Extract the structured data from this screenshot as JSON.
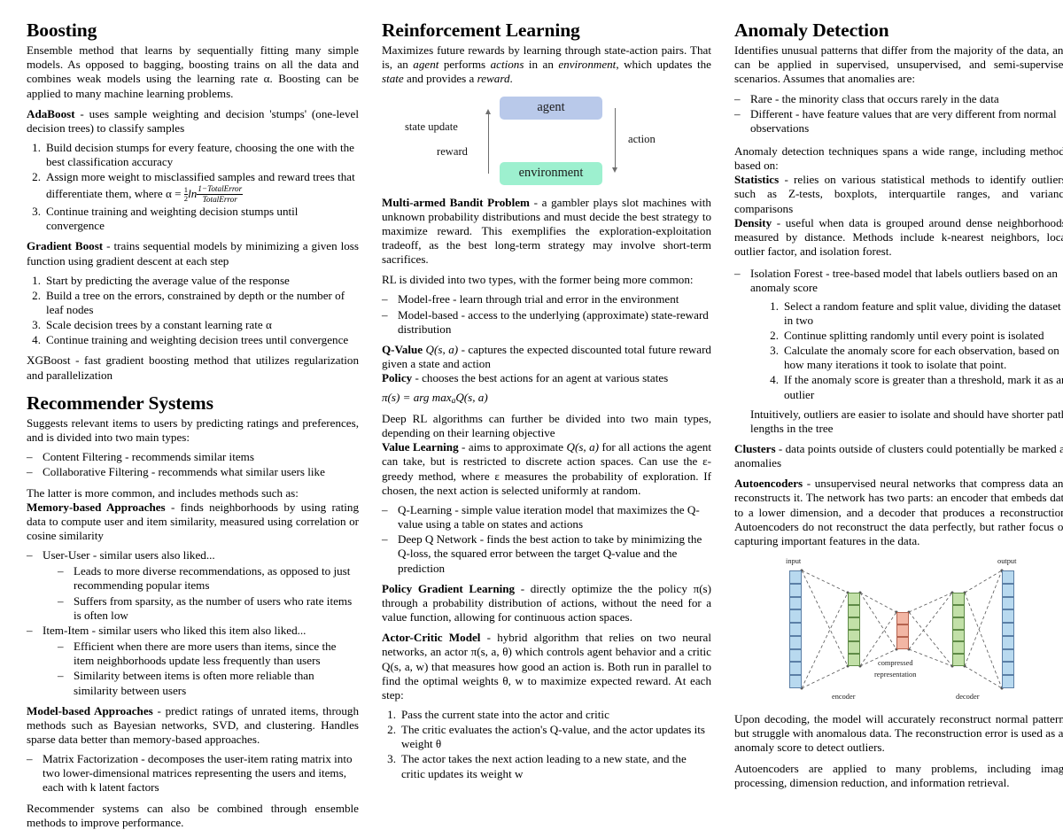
{
  "colors": {
    "agent_box": "#b9c9ea",
    "environment_box": "#9df0cf",
    "ae_input": "#b8d9ef",
    "ae_hidden": "#c2e0a8",
    "ae_compressed": "#f2b6a4",
    "ae_line": "#555555",
    "page_bg": "#ffffff",
    "text": "#000000"
  },
  "left_column": {
    "boosting": {
      "heading": "Boosting",
      "intro": "Ensemble method that learns by sequentially fitting many simple models. As opposed to bagging, boosting trains on all the data and combines weak models using the learning rate α. Boosting can be applied to many machine learning problems.",
      "adaboost_term": "AdaBoost",
      "adaboost_desc": " - uses sample weighting and decision 'stumps' (one-level decision trees) to classify samples",
      "adaboost_steps": [
        {
          "n": "1.",
          "text": "Build decision stumps for every feature, choosing the one with the best classification accuracy"
        },
        {
          "n": "2.",
          "text_before": "Assign more weight to misclassified samples and reward trees that differentiate them, where α = ",
          "formula_numerator": "1−TotalError",
          "formula_denominator": "TotalError",
          "formula_coefficient": "ln"
        },
        {
          "n": "3.",
          "text": "Continue training and weighting decision stumps until convergence"
        }
      ],
      "gradient_term": "Gradient Boost",
      "gradient_desc": " - trains sequential models by minimizing a given loss function using gradient descent at each step",
      "gradient_steps": [
        {
          "n": "1.",
          "text": "Start by predicting the average value of the response"
        },
        {
          "n": "2.",
          "text": "Build a tree on the errors, constrained by depth or the number of leaf nodes"
        },
        {
          "n": "3.",
          "text": "Scale decision trees by a constant learning rate α"
        },
        {
          "n": "4.",
          "text": "Continue training and weighting decision trees until convergence"
        }
      ],
      "xgboost": "XGBoost - fast gradient boosting method that utilizes regularization and parallelization"
    },
    "recommender": {
      "heading": "Recommender Systems",
      "intro": "Suggests relevant items to users by predicting ratings and preferences, and is divided into two main types:",
      "types": [
        "Content Filtering - recommends similar items",
        "Collaborative Filtering - recommends what similar users like"
      ],
      "latter": "The latter is more common, and includes methods such as:",
      "memory_term": "Memory-based Approaches",
      "memory_desc": " - finds neighborhoods by using rating data to compute user and item similarity, measured using correlation or cosine similarity",
      "user_user": "User-User - similar users also liked...",
      "user_user_sub": [
        "Leads to more diverse recommendations, as opposed to just recommending popular items",
        "Suffers from sparsity, as the number of users who rate items is often low"
      ],
      "item_item": "Item-Item - similar users who liked this item also liked...",
      "item_item_sub": [
        "Efficient when there are more users than items, since the item neighborhoods update less frequently than users",
        "Similarity between items is often more reliable than similarity between users"
      ],
      "model_term": "Model-based Approaches",
      "model_desc": " - predict ratings of unrated items, through methods such as Bayesian networks, SVD, and clustering. Handles sparse data better than memory-based approaches.",
      "matrix_factorization": "Matrix Factorization - decomposes the user-item rating matrix into two lower-dimensional matrices representing the users and items, each with k latent factors",
      "ensemble": "Recommender systems can also be combined through ensemble methods to improve performance."
    }
  },
  "middle_column": {
    "heading": "Reinforcement Learning",
    "intro_a": "Maximizes future rewards by learning through state-action pairs. That is, an ",
    "intro_agent": "agent",
    "intro_b": " performs ",
    "intro_actions": "actions",
    "intro_c": " in an ",
    "intro_environment": "environment",
    "intro_d": ", which updates the ",
    "intro_state": "state",
    "intro_e": " and provides a ",
    "intro_reward": "reward",
    "intro_f": ".",
    "diagram": {
      "agent_label": "agent",
      "environment_label": "environment",
      "state_update_label": "state update",
      "reward_label": "reward",
      "action_label": "action"
    },
    "bandit_term": "Multi-armed Bandit Problem",
    "bandit_desc": " - a gambler plays slot machines with unknown probability distributions and must decide the best strategy to maximize reward. This exemplifies the exploration-exploitation tradeoff, as the best long-term strategy may involve short-term sacrifices.",
    "rl_types_intro": "RL is divided into two types, with the former being more common:",
    "rl_types": [
      "Model-free - learn through trial and error in the environment",
      "Model-based - access to the underlying (approximate) state-reward distribution"
    ],
    "qvalue_term": "Q-Value",
    "qvalue_math": "Q(s, a)",
    "qvalue_desc": " - captures the expected discounted total future reward given a state and action",
    "policy_term": "Policy",
    "policy_desc": " - chooses the best actions for an agent at various states",
    "policy_formula_lhs": "π(s) = arg max",
    "policy_formula_sub": "a",
    "policy_formula_rhs": "Q(s, a)",
    "deeprl": "Deep RL algorithms can further be divided into two main types, depending on their learning objective",
    "value_learning_term": "Value Learning",
    "value_learning_desc_a": " - aims to approximate ",
    "value_learning_math": "Q(s, a)",
    "value_learning_desc_b": " for all actions the agent can take, but is restricted to discrete action spaces. Can use the ε-greedy method, where ε measures the probability of exploration. If chosen, the next action is selected uniformly at random.",
    "value_items": [
      "Q-Learning - simple value iteration model that maximizes the Q-value using a table on states and actions",
      "Deep Q Network - finds the best action to take by minimizing the Q-loss, the squared error between the target Q-value and the prediction"
    ],
    "pg_term": "Policy Gradient Learning",
    "pg_desc": " - directly optimize the the policy π(s) through a probability distribution of actions, without the need for a value function, allowing for continuous action spaces.",
    "ac_term": "Actor-Critic Model",
    "ac_desc": " - hybrid algorithm that relies on two neural networks, an actor π(s, a, θ) which controls agent behavior and a critic Q(s, a, w) that measures how good an action is. Both run in parallel to find the optimal weights θ, w to maximize expected reward. At each step:",
    "ac_steps": [
      {
        "n": "1.",
        "text": "Pass the current state into the actor and critic"
      },
      {
        "n": "2.",
        "text": "The critic evaluates the action's Q-value, and the actor updates its weight θ"
      },
      {
        "n": "3.",
        "text": "The actor takes the next action leading to a new state, and the critic updates its weight w"
      }
    ]
  },
  "right_column": {
    "heading": "Anomaly Detection",
    "intro": "Identifies unusual patterns that differ from the majority of the data, and can be applied in supervised, unsupervised, and semi-supervised scenarios. Assumes that anomalies are:",
    "assumptions": [
      "Rare - the minority class that occurs rarely in the data",
      "Different - have feature values that are very different from normal observations"
    ],
    "techniques_intro": "Anomaly detection techniques spans a wide range, including methods based on:",
    "statistics_term": "Statistics",
    "statistics_desc": " - relies on various statistical methods to identify outliers, such as Z-tests, boxplots, interquartile ranges, and variance comparisons",
    "density_term": "Density",
    "density_desc": " - useful when data is grouped around dense neighborhoods, measured by distance. Methods include k-nearest neighbors, local outlier factor, and isolation forest.",
    "isolation_forest": "Isolation Forest - tree-based model that labels outliers based on an anomaly score",
    "isolation_steps": [
      {
        "n": "1.",
        "text": "Select a random feature and split value, dividing the dataset in two"
      },
      {
        "n": "2.",
        "text": "Continue splitting randomly until every point is isolated"
      },
      {
        "n": "3.",
        "text": "Calculate the anomaly score for each observation, based on how many iterations it took to isolate that point."
      },
      {
        "n": "4.",
        "text": "If the anomaly score is greater than a threshold, mark it as an outlier"
      }
    ],
    "intuitively": "Intuitively, outliers are easier to isolate and should have shorter path lengths in the tree",
    "clusters_term": "Clusters",
    "clusters_desc": " - data points outside of clusters could potentially be marked as anomalies",
    "autoencoders_term": "Autoencoders",
    "autoencoders_desc": " - unsupervised neural networks that compress data and reconstructs it. The network has two parts: an encoder that embeds data to a lower dimension, and a decoder that produces a reconstruction. Autoencoders do not reconstruct the data perfectly, but rather focus on capturing important features in the data.",
    "ae_diagram": {
      "input_label": "input",
      "output_label": "output",
      "encoder_label": "encoder",
      "decoder_label": "decoder",
      "compressed_label_line1": "compressed",
      "compressed_label_line2": "representation",
      "input_cells": 9,
      "hidden_cells": 6,
      "compressed_cells": 3,
      "output_cells": 9
    },
    "upon_decoding": "Upon decoding, the model will accurately reconstruct normal patterns but struggle with anomalous data. The reconstruction error is used as an anomaly score to detect outliers.",
    "applied": "Autoencoders are applied to many problems, including image processing, dimension reduction, and information retrieval."
  }
}
